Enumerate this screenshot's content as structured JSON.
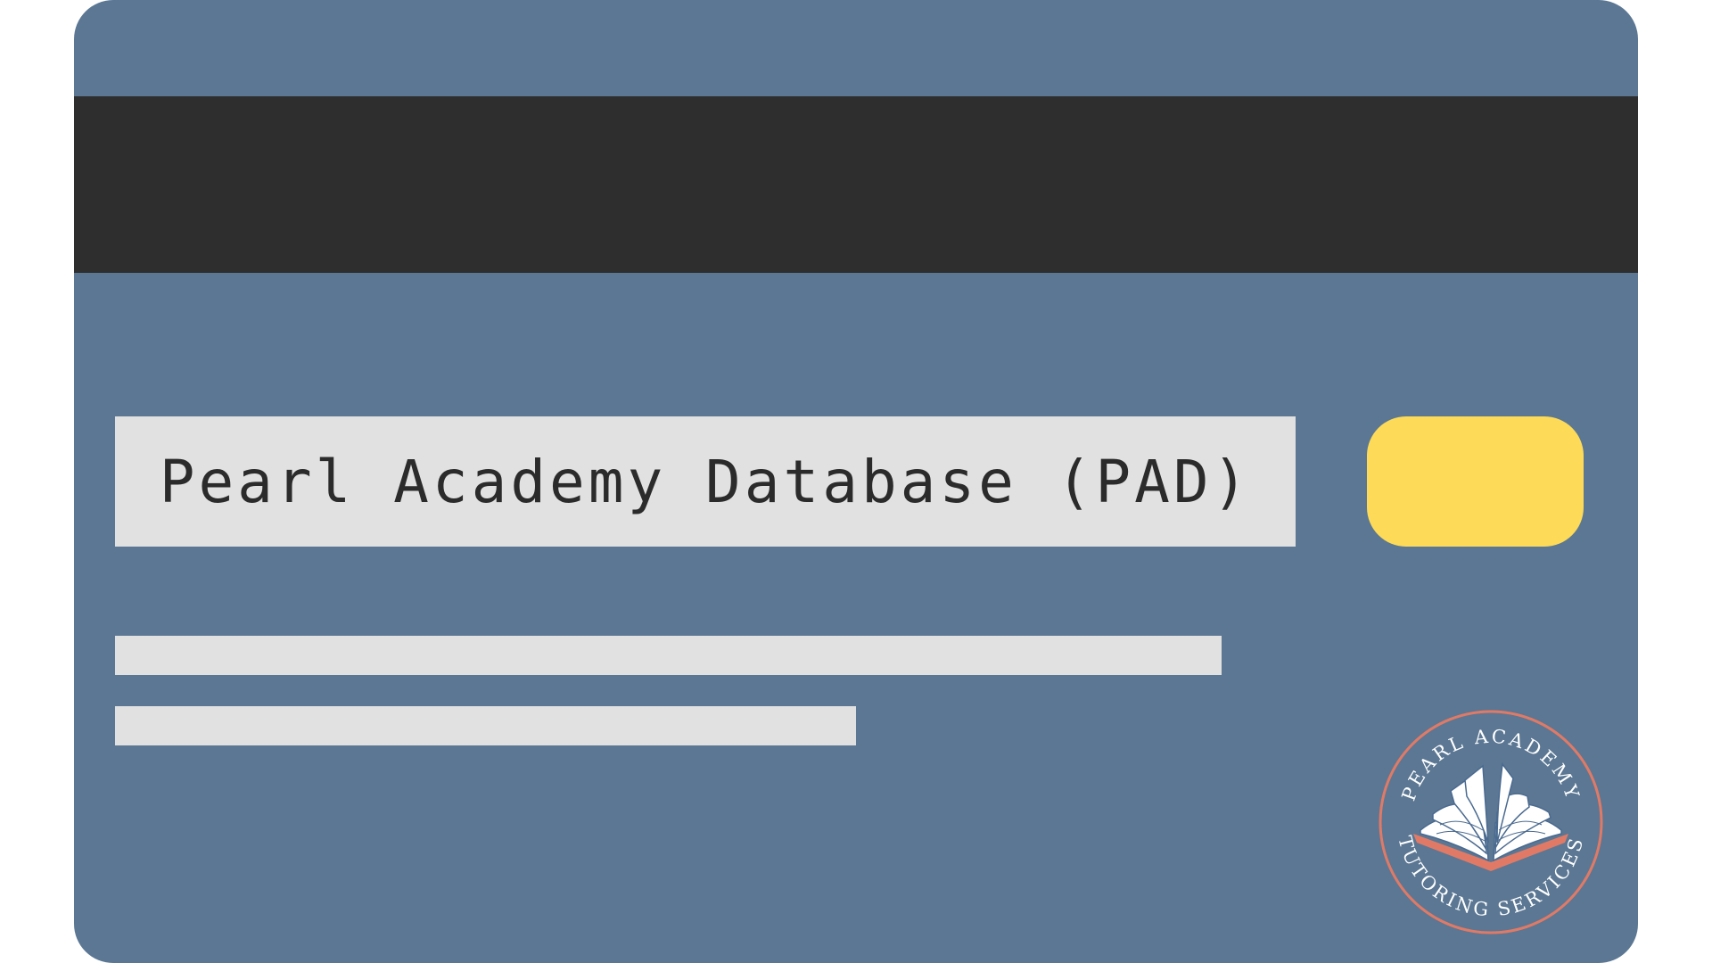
{
  "card": {
    "title": "Pearl Academy Database (PAD)"
  },
  "seal": {
    "top_text": "PEARL ACADEMY",
    "bottom_text": "TUTORING SERVICES",
    "icon": "open-book-icon"
  },
  "colors": {
    "card_background": "#5b7793",
    "stripe": "#2e2e2e",
    "panel": "#e1e1e1",
    "chip": "#fddb58",
    "seal_ring": "#e07a66",
    "book_cover": "#e07a66",
    "book_pages": "#ffffff",
    "book_lines": "#4a6a90"
  }
}
